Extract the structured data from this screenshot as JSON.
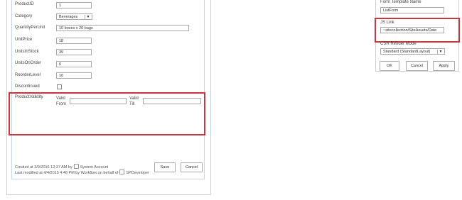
{
  "form": {
    "fields": [
      {
        "key": "productid",
        "label": "ProductID",
        "value": "1"
      },
      {
        "key": "category",
        "label": "Category",
        "value": "Beverages"
      },
      {
        "key": "quantityperunit",
        "label": "QuantityPerUnit",
        "value": "10 boxes x 20 bags"
      },
      {
        "key": "unitprice",
        "label": "UnitPrice",
        "value": "18"
      },
      {
        "key": "unitsinstock",
        "label": "UnitsInStock",
        "value": "39"
      },
      {
        "key": "unitsonorder",
        "label": "UnitsOnOrder",
        "value": "0"
      },
      {
        "key": "reorderlevel",
        "label": "ReorderLevel",
        "value": "10"
      },
      {
        "key": "discontinued",
        "label": "Discontinued",
        "value": ""
      }
    ],
    "validity": {
      "label": "ProductValidity",
      "from_label_1": "Valid",
      "from_label_2": "From",
      "till_label_1": "Valid",
      "till_label_2": "Till",
      "from_value": "",
      "till_value": ""
    },
    "footer": {
      "created_prefix": "Created at 3/9/2015 12:37 AM  by",
      "created_user": "System Account",
      "modified_prefix": "Last modified at 4/4/2015 4:46 PM  by Workflow on behalf of",
      "modified_user": "SPDeveloper"
    },
    "buttons": {
      "save": "Save",
      "cancel": "Cancel"
    }
  },
  "panel": {
    "template_label": "Form Template Name",
    "template_value": "ListForm",
    "jslink_label": "JS Link",
    "jslink_value": "~sitecollection/SiteAssets/Date",
    "csr_label": "CSR Render Mode",
    "csr_value": "Standard (StandardLayout)",
    "buttons": {
      "ok": "OK",
      "cancel": "Cancel",
      "apply": "Apply"
    }
  },
  "colors": {
    "highlight": "#c8353b",
    "frame": "#c6d4e6"
  }
}
